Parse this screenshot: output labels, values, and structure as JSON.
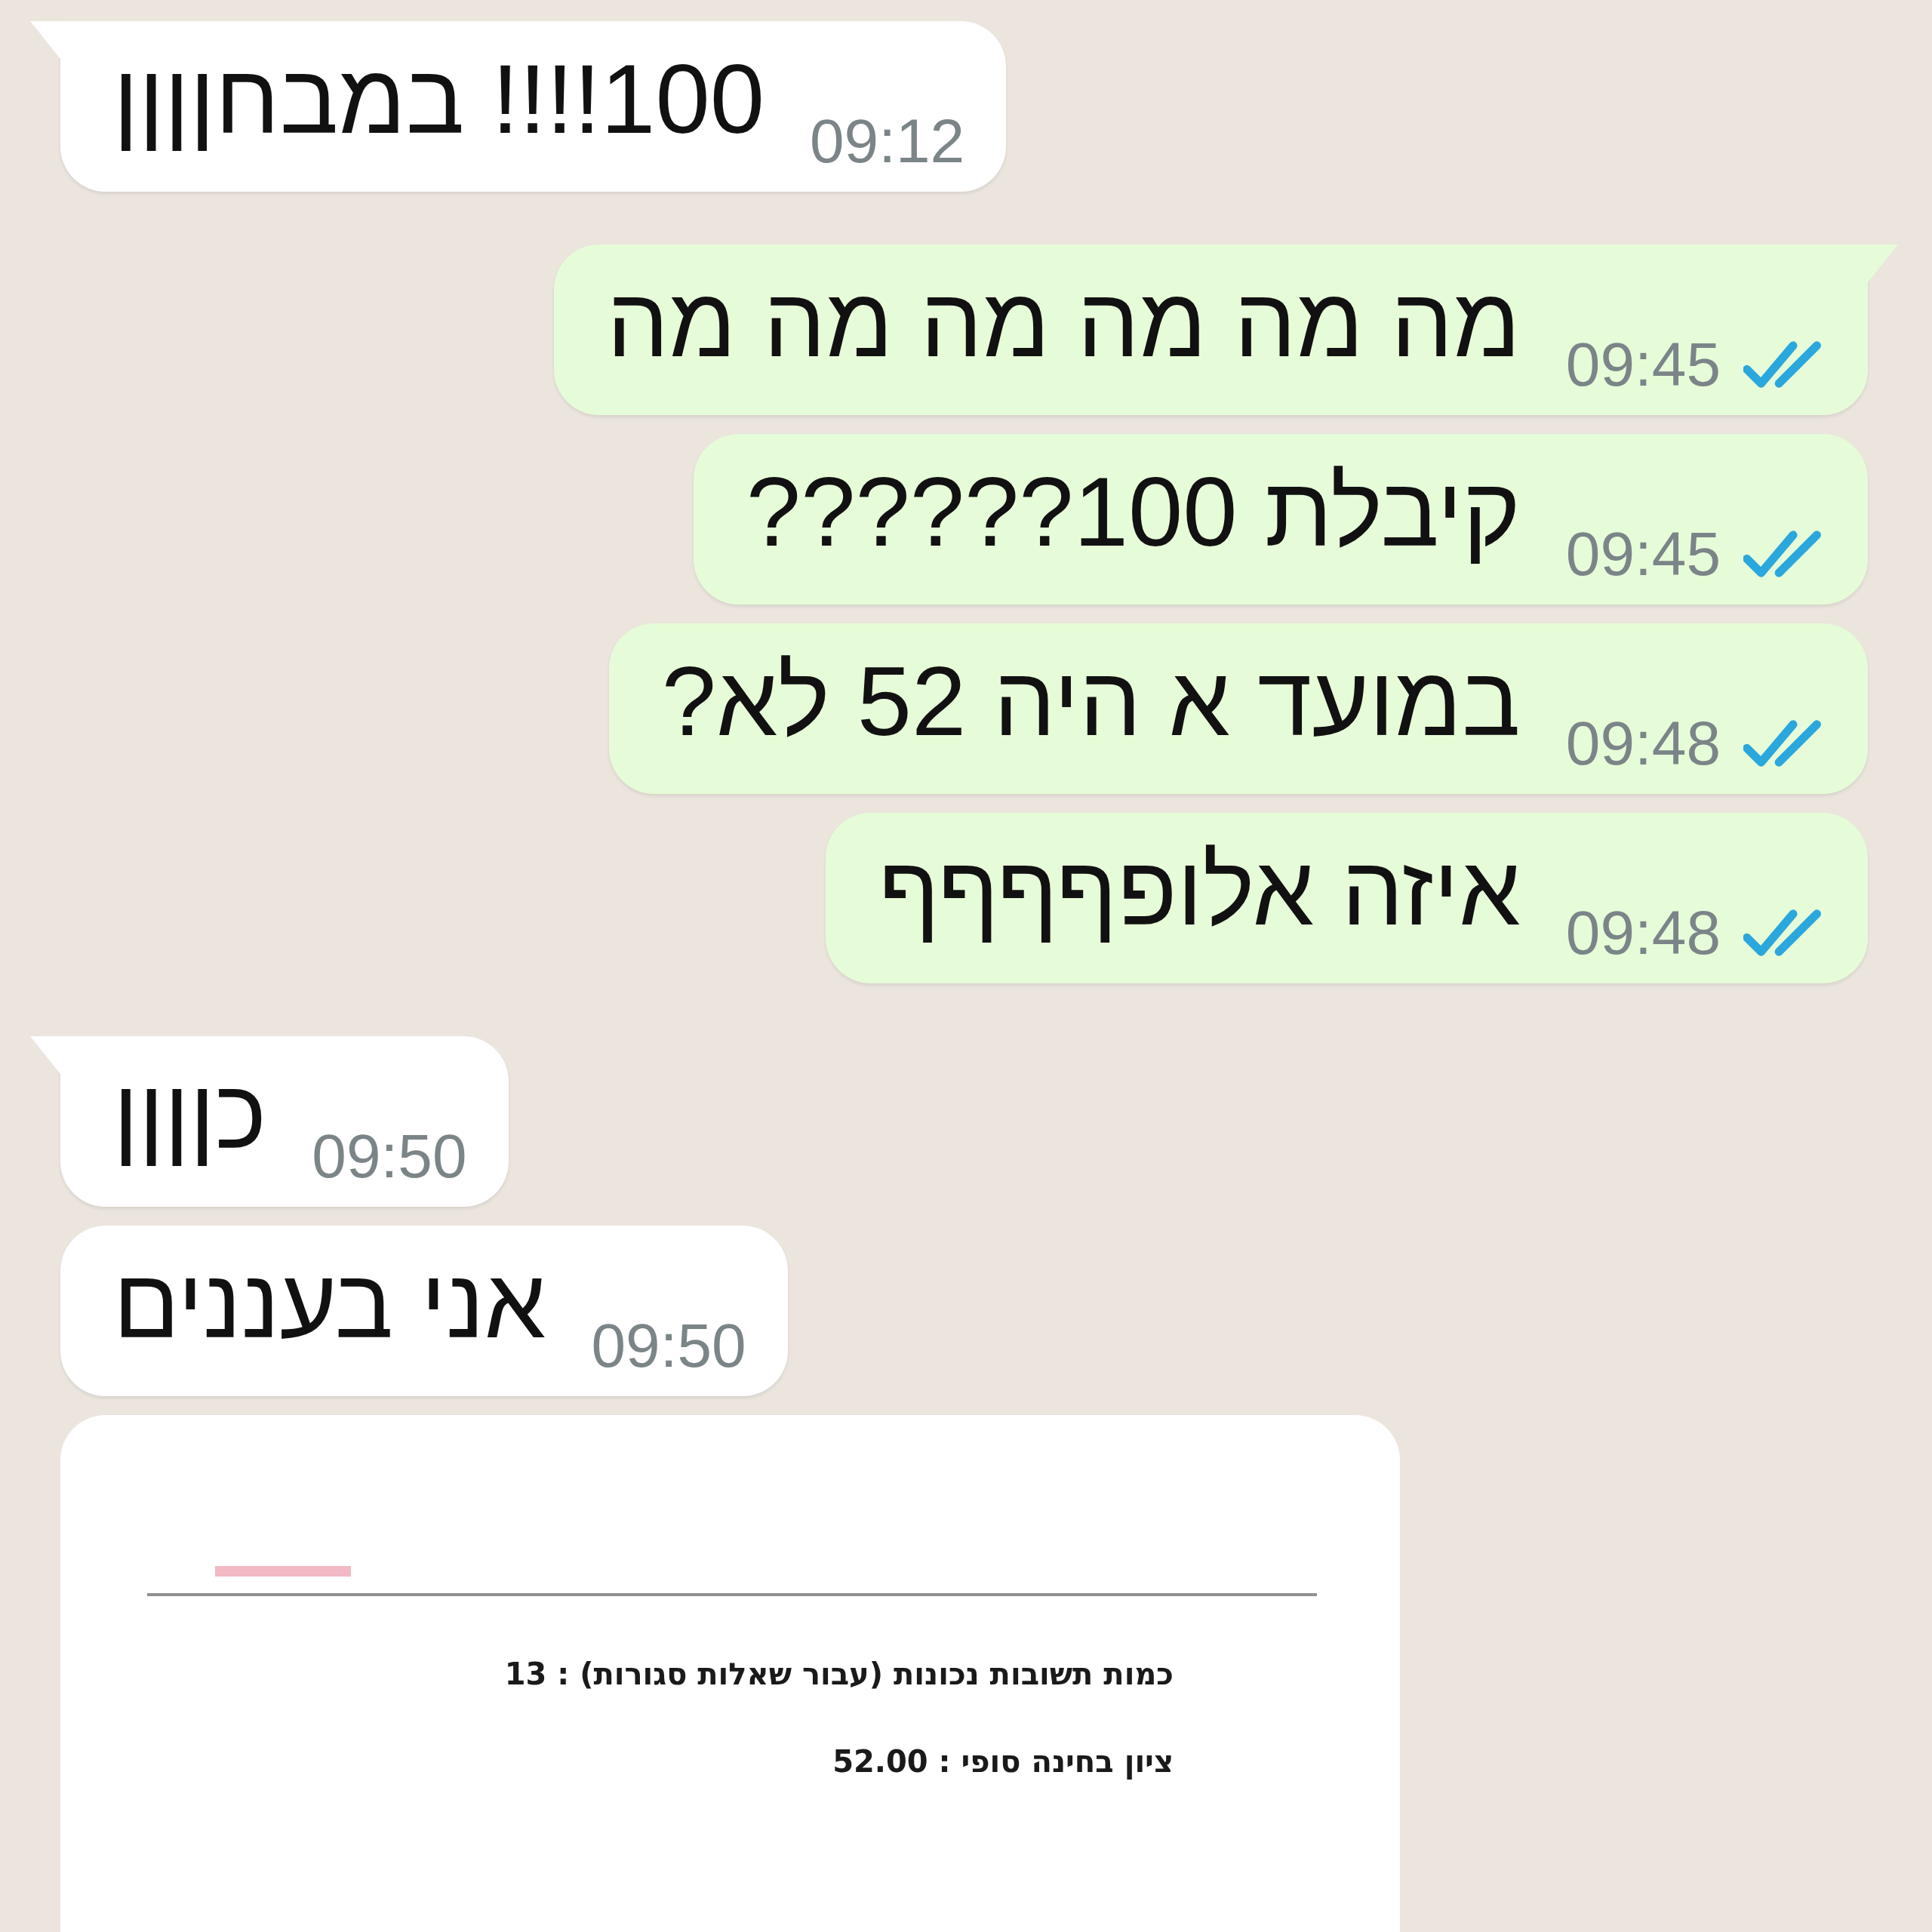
{
  "messages": [
    {
      "kind": "text",
      "outgoing": false,
      "tail": true,
      "text": "100!!!! במבחןןןן",
      "time": "09:12"
    },
    {
      "kind": "text",
      "outgoing": true,
      "tail": true,
      "text": "מה מה מה מה מה מה",
      "time": "09:45",
      "read": true
    },
    {
      "kind": "text",
      "outgoing": true,
      "tail": false,
      "text": "קיבלת 100??????",
      "time": "09:45",
      "read": true
    },
    {
      "kind": "text",
      "outgoing": true,
      "tail": false,
      "text": "במועד א היה 52 לא?",
      "time": "09:48",
      "read": true
    },
    {
      "kind": "text",
      "outgoing": true,
      "tail": false,
      "text": "איזה אלופףףףף",
      "time": "09:48",
      "read": true
    },
    {
      "kind": "text",
      "outgoing": false,
      "tail": true,
      "text": "כןןןן",
      "time": "09:50"
    },
    {
      "kind": "text",
      "outgoing": false,
      "tail": false,
      "text": "אני בעננים",
      "time": "09:50"
    },
    {
      "kind": "document",
      "outgoing": false,
      "lines": [
        "כמות תשובות נכונות (עבור שאלות סגורות) : 13",
        "ציון בחינה סופי : 52.00"
      ]
    }
  ]
}
